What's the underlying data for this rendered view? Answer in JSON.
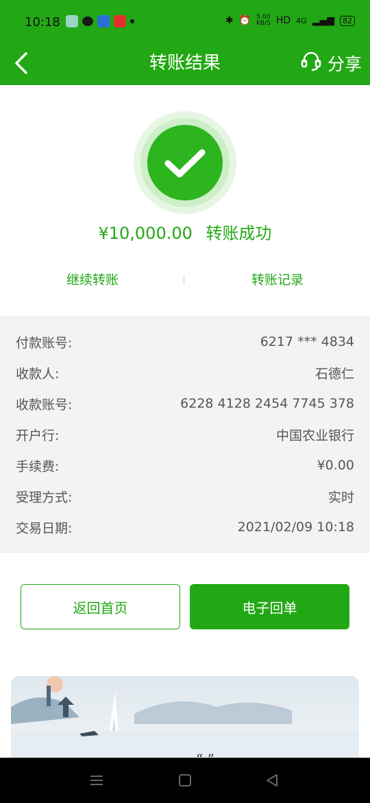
{
  "status_bar": {
    "time": "10:18",
    "speed": "5.00\nKB/S",
    "hd": "HD",
    "network": "4G",
    "battery": "82"
  },
  "nav": {
    "title": "转账结果",
    "share_label": "分享",
    "back_icon": "chevron-left-icon",
    "service_icon": "headset-icon"
  },
  "result": {
    "amount": "¥10,000.00",
    "status": "转账成功",
    "continue_label": "继续转账",
    "records_label": "转账记录"
  },
  "details": [
    {
      "label": "付款账号:",
      "value": "6217 *** 4834"
    },
    {
      "label": "收款人:",
      "value": "石德仁"
    },
    {
      "label": "收款账号:",
      "value": "6228 4128 2454 7745 378"
    },
    {
      "label": "开户行:",
      "value": "中国农业银行"
    },
    {
      "label": "手续费:",
      "value": "¥0.00"
    },
    {
      "label": "受理方式:",
      "value": "实时"
    },
    {
      "label": "交易日期:",
      "value": "2021/02/09 10:18"
    }
  ],
  "buttons": {
    "home": "返回首页",
    "receipt": "电子回单"
  },
  "colors": {
    "brand_green": "#22a814",
    "check_green": "#2db51f"
  }
}
